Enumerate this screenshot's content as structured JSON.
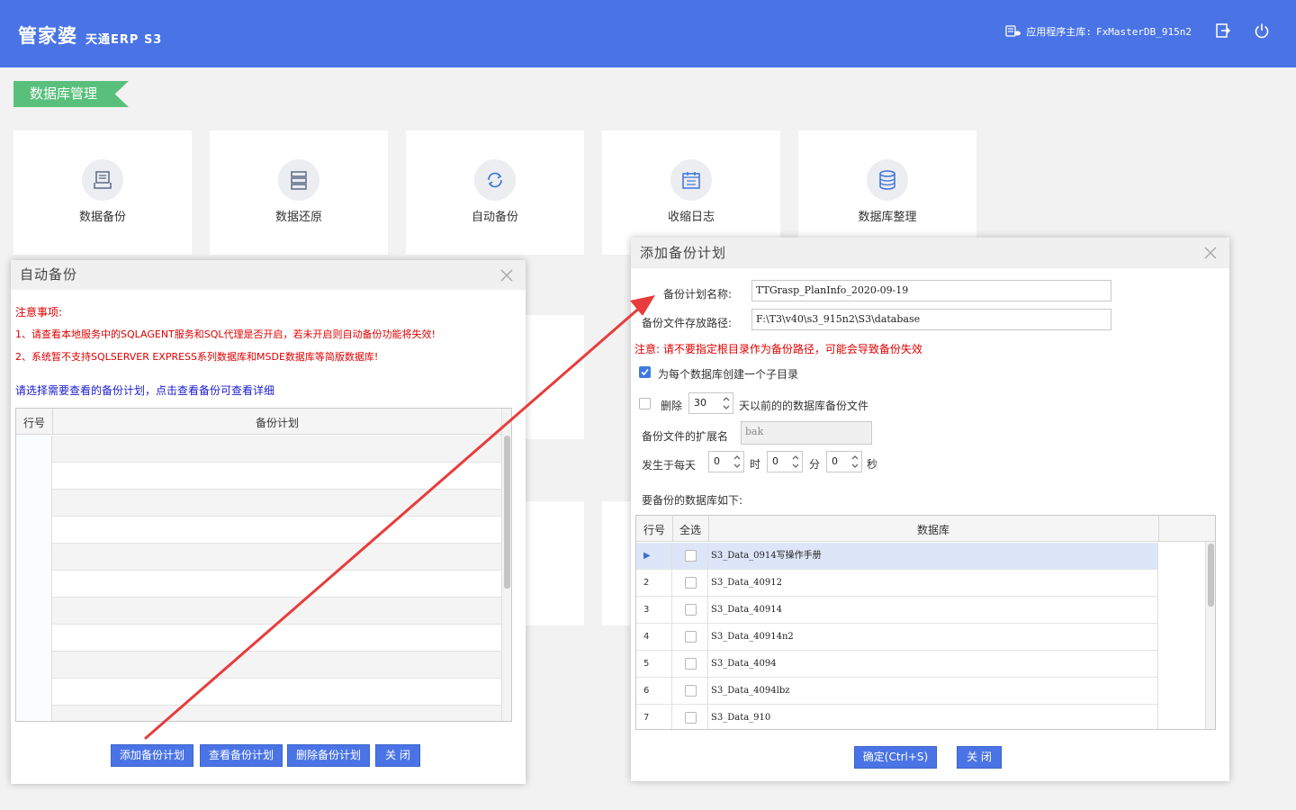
{
  "header": {
    "logo": "管家婆",
    "logo_sub": "天通ERP S3",
    "db_label": "应用程序主库:",
    "db_value": "FxMasterDB_915n2"
  },
  "section_title": "数据库管理",
  "tiles": [
    {
      "label": "数据备份",
      "icon": "backup-icon"
    },
    {
      "label": "数据还原",
      "icon": "restore-icon"
    },
    {
      "label": "自动备份",
      "icon": "refresh-icon"
    },
    {
      "label": "收缩日志",
      "icon": "calendar-icon"
    },
    {
      "label": "数据库整理",
      "icon": "database-icon"
    }
  ],
  "auto_backup_dialog": {
    "title": "自动备份",
    "notice_title": "注意事项:",
    "notice_1": "1、请查看本地服务中的SQLAGENT服务和SQL代理是否开启，若未开启则自动备份功能将失效!",
    "notice_2": "2、系统暂不支持SQLSERVER EXPRESS系列数据库和MSDE数据库等简版数据库!",
    "instruction": "请选择需要查看的备份计划，点击查看备份可查看详细",
    "col_index": "行号",
    "col_plan": "备份计划",
    "buttons": {
      "add": "添加备份计划",
      "view": "查看备份计划",
      "delete": "删除备份计划",
      "close": "关 闭"
    }
  },
  "add_plan_dialog": {
    "title": "添加备份计划",
    "plan_name_label": "备份计划名称:",
    "plan_name_value": "TTGrasp_PlanInfo_2020-09-19",
    "path_label": "备份文件存放路径:",
    "path_value": "F:\\T3\\v40\\s3_915n2\\S3\\database",
    "warning": "注意: 请不要指定根目录作为备份路径，可能会导致备份失效",
    "subdir_label": "为每个数据库创建一个子目录",
    "subdir_checked": true,
    "delete_label": "删除",
    "delete_days": "30",
    "delete_suffix": "天以前的的数据库备份文件",
    "delete_checked": false,
    "ext_label": "备份文件的扩展名",
    "ext_value": "bak",
    "daily_label": "发生于每天",
    "hour_value": "0",
    "hour_unit": "时",
    "minute_value": "0",
    "minute_unit": "分",
    "second_value": "0",
    "second_unit": "秒",
    "db_list_label": "要备份的数据库如下:",
    "col_index": "行号",
    "col_select_all": "全选",
    "col_database": "数据库",
    "rows": [
      {
        "index": "▶",
        "name": "S3_Data_0914写操作手册"
      },
      {
        "index": "2",
        "name": "S3_Data_40912"
      },
      {
        "index": "3",
        "name": "S3_Data_40914"
      },
      {
        "index": "4",
        "name": "S3_Data_40914n2"
      },
      {
        "index": "5",
        "name": "S3_Data_4094"
      },
      {
        "index": "6",
        "name": "S3_Data_4094lbz"
      },
      {
        "index": "7",
        "name": "S3_Data_910"
      }
    ],
    "buttons": {
      "confirm": "确定(Ctrl+S)",
      "close": "关 闭"
    }
  },
  "colors": {
    "header_blue": "#4a74e6",
    "section_green": "#58c07b",
    "arrow_red": "#e83c3c"
  }
}
